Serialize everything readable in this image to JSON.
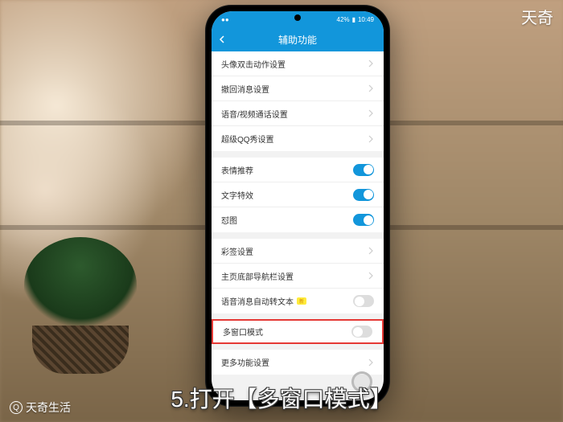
{
  "watermark_top": "天奇",
  "watermark_bottom": "天奇生活",
  "caption": "5.打开【多窗口模式】",
  "statusbar": {
    "battery": "42%",
    "time": "10:49"
  },
  "header": {
    "title": "辅助功能"
  },
  "sections": [
    {
      "rows": [
        {
          "label": "头像双击动作设置",
          "type": "nav"
        },
        {
          "label": "撤回消息设置",
          "type": "nav"
        },
        {
          "label": "语音/视频通话设置",
          "type": "nav"
        },
        {
          "label": "超级QQ秀设置",
          "type": "nav"
        }
      ]
    },
    {
      "rows": [
        {
          "label": "表情推荐",
          "type": "toggle",
          "on": true
        },
        {
          "label": "文字特效",
          "type": "toggle",
          "on": true
        },
        {
          "label": "怼图",
          "type": "toggle",
          "on": true
        }
      ]
    },
    {
      "rows": [
        {
          "label": "彩签设置",
          "type": "nav"
        },
        {
          "label": "主页底部导航栏设置",
          "type": "nav"
        },
        {
          "label": "语音消息自动转文本",
          "type": "toggle",
          "on": false,
          "badge": "新"
        }
      ]
    },
    {
      "rows": [
        {
          "label": "多窗口模式",
          "type": "toggle",
          "on": false,
          "highlight": true
        }
      ]
    },
    {
      "rows": [
        {
          "label": "更多功能设置",
          "type": "nav"
        }
      ]
    }
  ]
}
